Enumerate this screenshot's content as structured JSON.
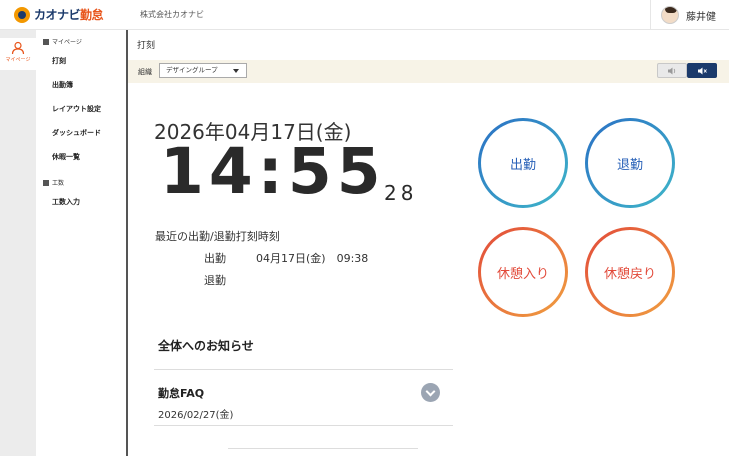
{
  "header": {
    "logo_text_main": "カオナビ",
    "logo_text_accent": "勤怠",
    "company": "株式会社カオナビ",
    "user_name": "藤井健"
  },
  "rail": {
    "active_label": "マイページ"
  },
  "nav": {
    "section_mypage": "マイページ",
    "items_mypage": [
      "打刻",
      "出勤簿",
      "レイアウト設定",
      "ダッシュボード",
      "休暇一覧"
    ],
    "section_worktime": "工数",
    "items_worktime": [
      "工数入力"
    ]
  },
  "page": {
    "title": "打刻"
  },
  "toolbar": {
    "group_label": "組織",
    "group_value": "デザイングループ",
    "sound_on_icon": "speaker-on-icon",
    "sound_off_icon": "speaker-mute-icon"
  },
  "clock": {
    "date": "2026年04月17日(金)",
    "hhmm": "14:55",
    "seconds": "28"
  },
  "recent": {
    "heading": "最近の出勤/退勤打刻時刻",
    "clock_in_label": "出勤",
    "clock_in_value": "04月17日(金)　09:38",
    "clock_out_label": "退勤",
    "clock_out_value": ""
  },
  "notices": {
    "heading": "全体へのお知らせ",
    "items": [
      {
        "title": "勤怠FAQ",
        "date": "2026/02/27(金)"
      }
    ]
  },
  "punch_buttons": {
    "clock_in": "出勤",
    "clock_out": "退勤",
    "break_start": "休憩入り",
    "break_end": "休憩戻り"
  },
  "colors": {
    "brand_navy": "#1b3a6b",
    "brand_orange": "#e8541a",
    "punch_blue": "#2a6fc4",
    "punch_red": "#e24a3a",
    "toolbar_bg": "#f7f3e7"
  }
}
